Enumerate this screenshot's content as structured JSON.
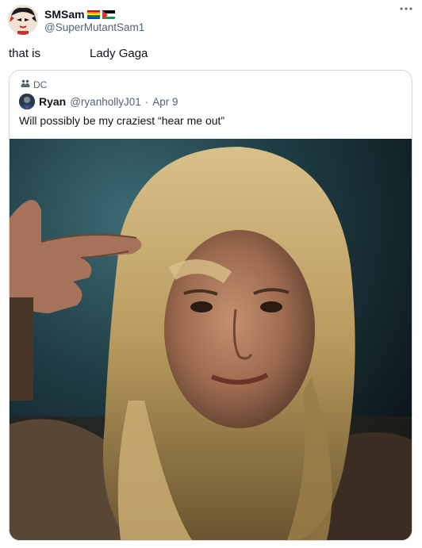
{
  "tweet": {
    "display_name": "SMSam",
    "handle": "@SuperMutantSam1",
    "text_part1": "that is",
    "text_part2": "Lady Gaga",
    "more_icon": "more-dots-icon"
  },
  "quote": {
    "community_label": "DC",
    "community_icon": "community-icon",
    "display_name": "Ryan",
    "handle": "@ryanhollyJ01",
    "separator": "·",
    "date": "Apr 9",
    "text": "Will possibly be my craziest “hear me out”"
  },
  "colors": {
    "text": "#0f1419",
    "secondary": "#536471",
    "border": "#cfd9de"
  }
}
